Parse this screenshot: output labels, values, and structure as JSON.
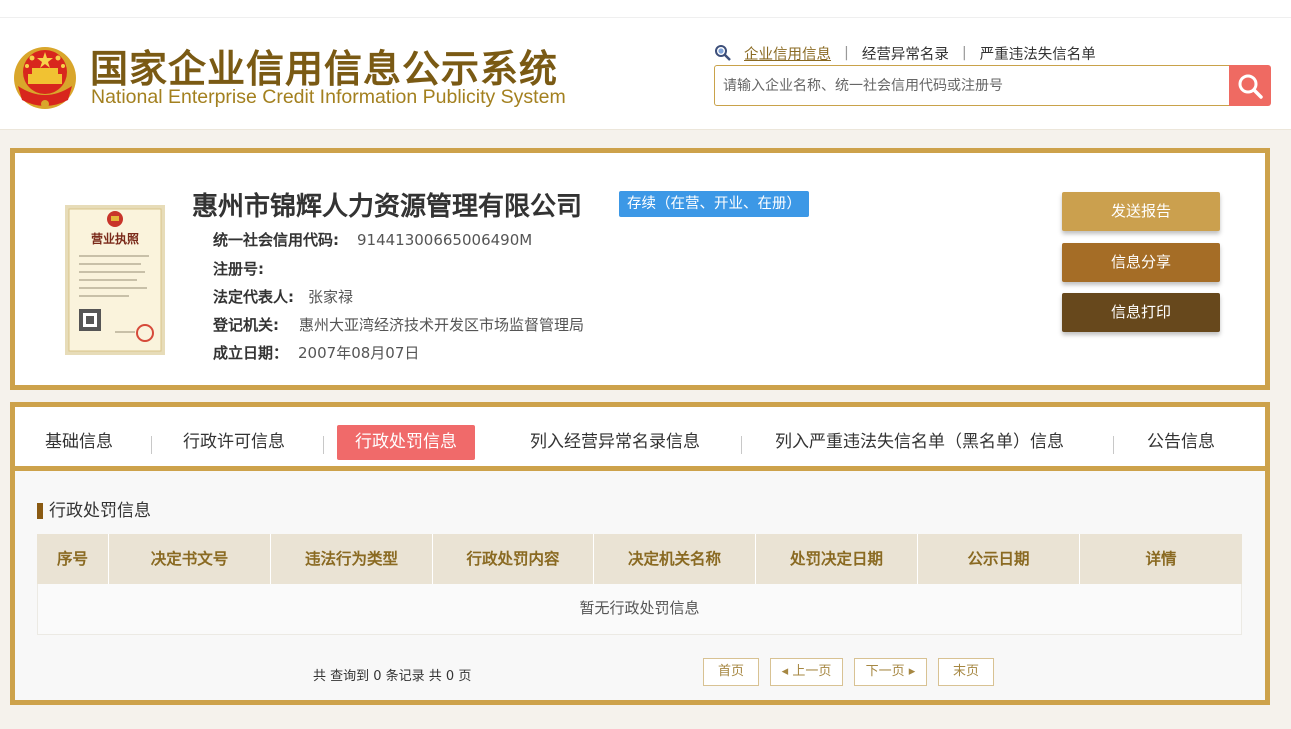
{
  "header": {
    "title_cn": "国家企业信用信息公示系统",
    "title_en": "National Enterprise Credit Information Publicity System",
    "nav": [
      "企业信用信息",
      "经营异常名录",
      "严重违法失信名单"
    ],
    "search_placeholder": "请输入企业名称、统一社会信用代码或注册号",
    "search_icon": "search-icon",
    "accent": "#cda24b"
  },
  "company": {
    "name": "惠州市锦辉人力资源管理有限公司",
    "status": "存续（在营、开业、在册）",
    "fields": [
      {
        "label": "统一社会信用代码:",
        "value": "91441300665006490M"
      },
      {
        "label": "注册号:",
        "value": ""
      },
      {
        "label": "法定代表人:",
        "value": "张家禄"
      },
      {
        "label": "登记机关:",
        "value": "惠州大亚湾经济技术开发区市场监督管理局"
      },
      {
        "label": "成立日期：",
        "value": "2007年08月07日"
      }
    ],
    "license_text": "营业执照",
    "actions": [
      "发送报告",
      "信息分享",
      "信息打印"
    ]
  },
  "tabs": [
    "基础信息",
    "行政许可信息",
    "行政处罚信息",
    "列入经营异常名录信息",
    "列入严重违法失信名单（黑名单）信息",
    "公告信息"
  ],
  "active_tab": "行政处罚信息",
  "section": {
    "title": "行政处罚信息",
    "columns": [
      "序号",
      "决定书文号",
      "违法行为类型",
      "行政处罚内容",
      "决定机关名称",
      "处罚决定日期",
      "公示日期",
      "详情"
    ],
    "empty_text": "暂无行政处罚信息"
  },
  "pagination": {
    "summary": "共 查询到 0 条记录 共 0 页",
    "buttons": [
      "首页",
      "◂ 上一页",
      "下一页 ▸",
      "末页"
    ]
  }
}
